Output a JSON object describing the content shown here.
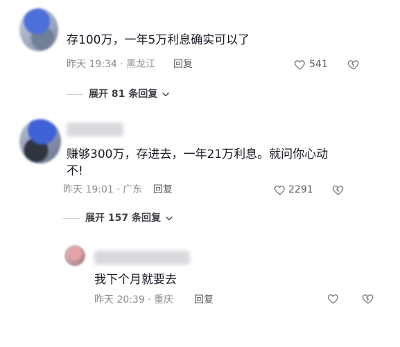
{
  "comments": [
    {
      "text": "存100万，一年5万利息确实可以了",
      "time": "昨天 19:34",
      "location": "黑龙江",
      "reply_label": "回复",
      "likes": "541",
      "expand": "展开 81 条回复"
    },
    {
      "text_line1": "赚够300万，存进去，一年21万利息。就问你心动",
      "text_line2": "不!",
      "time": "昨天 19:01",
      "location": "广东",
      "reply_label": "回复",
      "likes": "2291",
      "expand": "展开 157 条回复"
    }
  ],
  "reply": {
    "text": "我下个月就要去",
    "time": "昨天 20:39",
    "location": "重庆",
    "reply_label": "回复"
  },
  "separator": "·",
  "icons": {
    "like": "heart-outline-icon",
    "dislike": "broken-heart-icon",
    "expand": "chevron-down-icon"
  }
}
